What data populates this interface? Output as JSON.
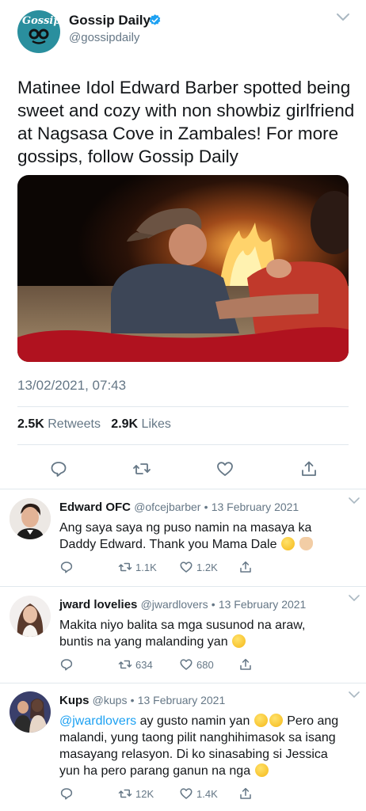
{
  "tweet": {
    "author_name": "Gossip Daily",
    "author_handle": "@gossipdaily",
    "avatar_text": "Gossip",
    "text": "Matinee Idol Edward Barber spotted being sweet and cozy with non showbiz girlfriend at Nagsasa Cove in Zambales! For more gossips, follow Gossip Daily",
    "timestamp": "13/02/2021, 07:43",
    "retweets_count": "2.5K",
    "retweets_label": "Retweets",
    "likes_count": "2.9K",
    "likes_label": "Likes"
  },
  "replies": [
    {
      "name": "Edward OFC",
      "handle": "@ofcejbarber",
      "date": "13 February 2021",
      "text_line1": "Ang saya saya ng puso namin na masaya ka",
      "text_line2": "Daddy Edward. Thank you Mama Dale",
      "retweets": "1.1K",
      "likes": "1.2K"
    },
    {
      "name": "jward lovelies",
      "handle": "@jwardlovers",
      "date": "13 February 2021",
      "text_line1": "Makita niyo balita sa mga susunod na araw,",
      "text_line2": "buntis na yang malanding yan",
      "retweets": "634",
      "likes": "680"
    },
    {
      "name": "Kups",
      "handle": "@kups",
      "date": "13 February 2021",
      "mention": "@jwardlovers",
      "text_a": " ay gusto namin yan ",
      "text_b": " Pero ang",
      "text_line2": "malandi, yung taong pilit nanghihimasok sa isang",
      "text_line3": "masayang relasyon. Di ko sinasabing si Jessica",
      "text_line4": "yun ha pero parang ganun na nga",
      "retweets": "12K",
      "likes": "1.4K"
    }
  ],
  "colors": {
    "accent": "#1da1f2",
    "secondary_text": "#657786",
    "border": "#e1e8ed"
  },
  "icons": [
    "verified-badge-icon",
    "chevron-down-icon",
    "reply-icon",
    "retweet-icon",
    "like-icon",
    "share-icon"
  ]
}
